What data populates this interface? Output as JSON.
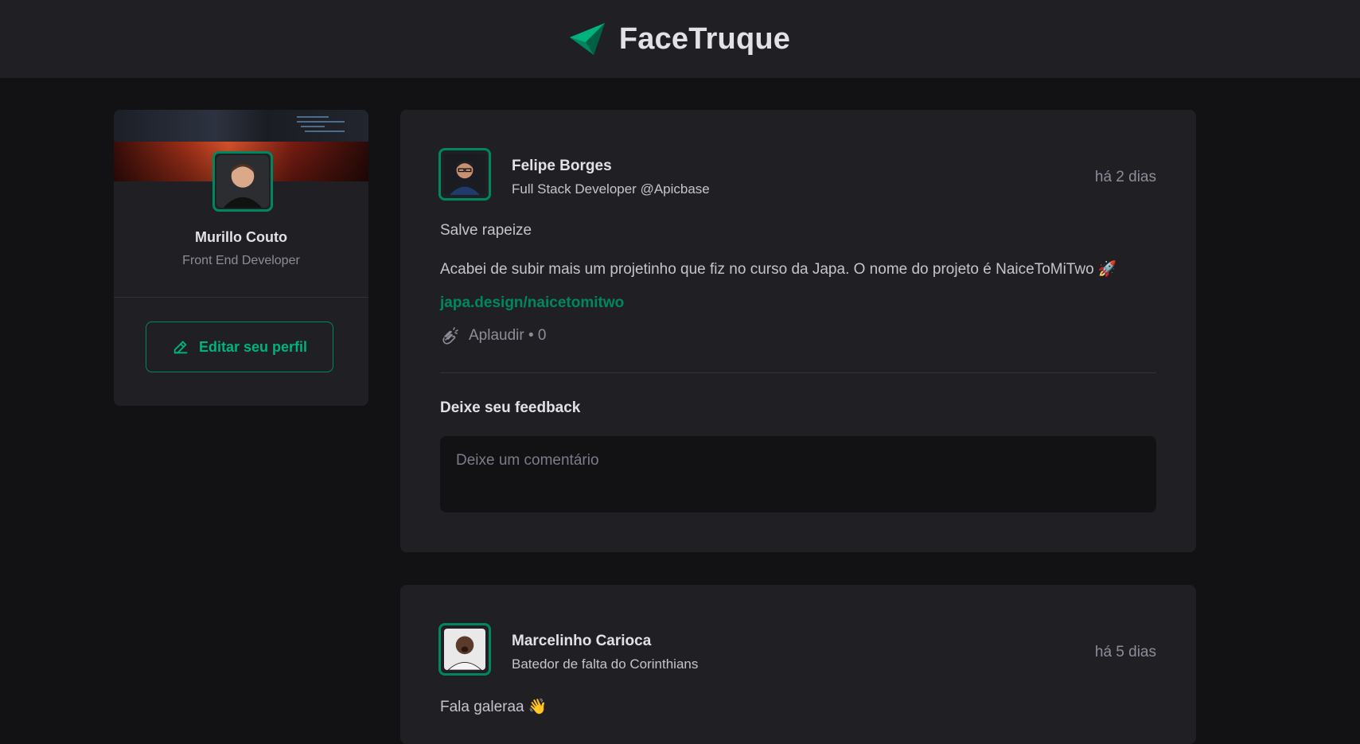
{
  "header": {
    "title": "FaceTruque"
  },
  "profile": {
    "name": "Murillo Couto",
    "role": "Front End Developer",
    "edit_label": "Editar seu perfil"
  },
  "posts": [
    {
      "author": "Felipe Borges",
      "role": "Full Stack Developer @Apicbase",
      "time": "há 2 dias",
      "paragraphs": [
        "Salve rapeize",
        "Acabei de subir mais um projetinho que fiz no curso da Japa. O nome do projeto é NaiceToMiTwo 🚀"
      ],
      "link": "japa.design/naicetomitwo",
      "applaud": "Aplaudir • 0",
      "feedback_title": "Deixe seu feedback",
      "comment_placeholder": "Deixe um comentário"
    },
    {
      "author": "Marcelinho Carioca",
      "role": "Batedor de falta do Corinthians",
      "time": "há 5 dias",
      "paragraphs": [
        "Fala galeraa 👋"
      ]
    }
  ],
  "colors": {
    "accent": "#00875f",
    "accent_light": "#00b37e",
    "background": "#121214",
    "card": "#202024"
  },
  "icons": {
    "logo": "paper-plane-logo",
    "edit": "pencil-icon",
    "applaud": "hands-clapping-icon"
  }
}
